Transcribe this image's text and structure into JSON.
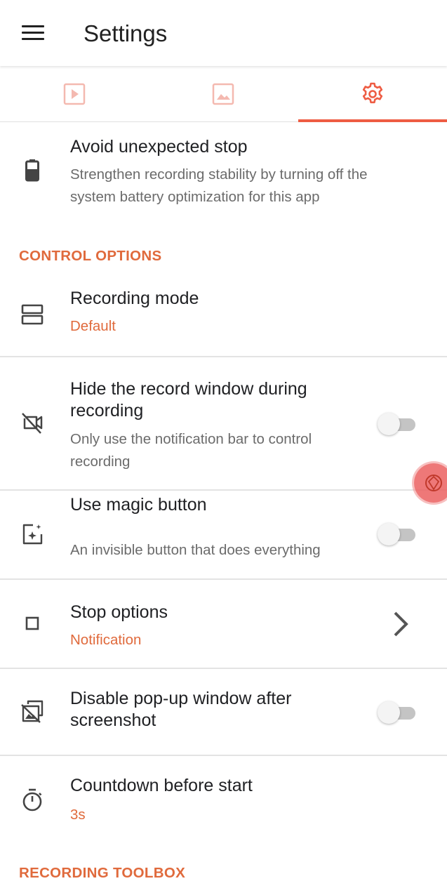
{
  "appbar": {
    "title": "Settings",
    "menu_icon": "hamburger-menu-icon"
  },
  "tabs": [
    {
      "icon": "video-play-icon",
      "active": false
    },
    {
      "icon": "image-icon",
      "active": false
    },
    {
      "icon": "gear-icon",
      "active": true
    }
  ],
  "colors": {
    "accent": "#ee5c43",
    "section": "#e06a3c",
    "inactive_tab": "#f4b9b0"
  },
  "battery_item": {
    "icon": "battery-icon",
    "title": "Avoid unexpected stop",
    "subtitle_lines": [
      "Strengthen recording stability by turning off the",
      "system battery optimization for this app"
    ]
  },
  "sections": {
    "control": "CONTROL OPTIONS",
    "toolbox": "RECORDING TOOLBOX"
  },
  "items": {
    "recording_mode": {
      "icon": "split-layout-icon",
      "title": "Recording mode",
      "value": "Default"
    },
    "hide_window": {
      "icon": "video-off-icon",
      "title_lines": [
        "Hide the record window during",
        "recording"
      ],
      "subtitle_lines": [
        "Only use the notification bar to control",
        "recording"
      ],
      "enabled": false
    },
    "magic_button": {
      "icon": "magic-sparkle-icon",
      "title": "Use magic button",
      "subtitle": "An invisible button that does everything",
      "enabled": false
    },
    "stop_options": {
      "icon": "stop-square-icon",
      "title": "Stop options",
      "value": "Notification"
    },
    "disable_popup": {
      "icon": "screenshot-off-icon",
      "title_lines": [
        "Disable pop-up window after",
        "screenshot"
      ],
      "enabled": false
    },
    "countdown": {
      "icon": "stopwatch-icon",
      "title": "Countdown before start",
      "value": "3s"
    }
  }
}
